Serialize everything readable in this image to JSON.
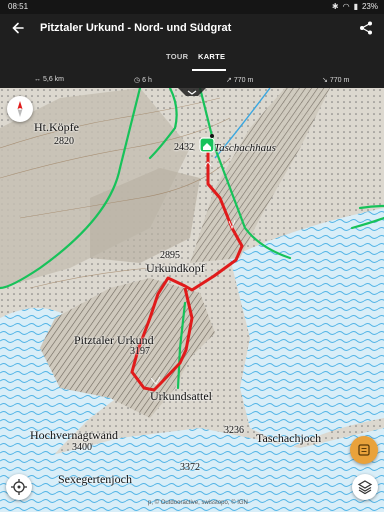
{
  "status": {
    "time": "08:51",
    "battery": "23%"
  },
  "appbar": {
    "title": "Pitztaler Urkund - Nord- und Südgrat"
  },
  "tabs": [
    {
      "label": "TOUR"
    },
    {
      "label": "KARTE"
    }
  ],
  "stats": {
    "distance": "5,6 km",
    "duration": "6 h",
    "ascent": "770 m",
    "descent": "770 m"
  },
  "map": {
    "labels": {
      "ht_kopfe": "Ht.Köpfe",
      "elev_2820": "2820",
      "elev_2432": "2432",
      "taschachhaus": "Taschachhaus",
      "elev_2895": "2895",
      "urkundkopf": "Urkundkopf",
      "pitztaler_urkund": "Pitztaler Urkund",
      "elev_3197": "3197",
      "urkundsattel": "Urkundsattel",
      "hochvernagtwand": "Hochvernagtwand",
      "elev_3400": "3400",
      "elev_3236": "3236",
      "taschachjoch": "Taschachjoch",
      "elev_3372": "3372",
      "sexegertenjoch": "Sexegertenjoch"
    },
    "attribution": "p, © Outdooractive, swisstopo, © IGN"
  },
  "colors": {
    "route": "#e01b1b",
    "trail": "#17c25a",
    "glacier": "#9fd8f2",
    "rock": "#c9c3b8",
    "accent": "#e9a23b"
  }
}
